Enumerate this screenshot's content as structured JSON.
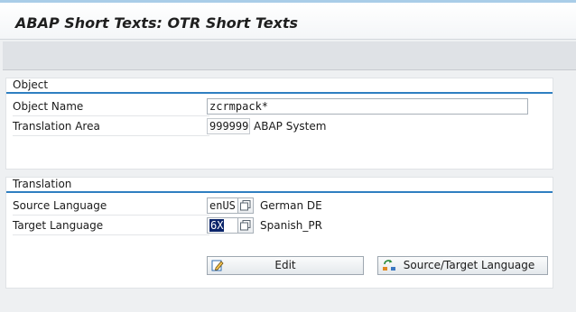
{
  "window": {
    "title": "ABAP Short Texts: OTR Short Texts"
  },
  "object_panel": {
    "title": "Object",
    "object_name": {
      "label": "Object Name",
      "value": "zcrmpack*"
    },
    "translation_area": {
      "label": "Translation Area",
      "value": "999999",
      "description": "ABAP System"
    }
  },
  "translation_panel": {
    "title": "Translation",
    "source_language": {
      "label": "Source Language",
      "value": "enUS",
      "description": "German DE"
    },
    "target_language": {
      "label": "Target Language",
      "value": "6X",
      "description": "Spanish_PR"
    }
  },
  "buttons": {
    "edit": {
      "label": "Edit",
      "icon": "edit-pencil-icon"
    },
    "source_target": {
      "label": "Source/Target Language",
      "icon": "swap-languages-icon"
    }
  },
  "colors": {
    "accent": "#2f7fc1",
    "selection": "#0a246a"
  }
}
